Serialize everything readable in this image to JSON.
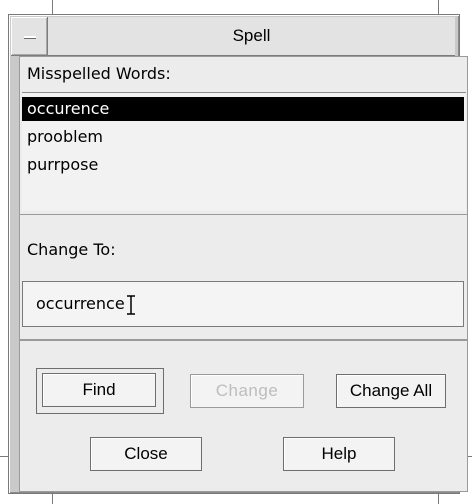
{
  "window": {
    "title": "Spell"
  },
  "misspelled": {
    "label": "Misspelled Words:",
    "words": [
      "occurence",
      "prooblem",
      "purrpose"
    ],
    "selected_index": 0
  },
  "change_to": {
    "label": "Change To:",
    "value": "occurrence"
  },
  "buttons": {
    "find": "Find",
    "change": "Change",
    "change_all": "Change All",
    "close": "Close",
    "help": "Help"
  },
  "colors": {
    "selection_bg": "#000000",
    "selection_fg": "#ffffff",
    "disabled_text": "#bdbdbd"
  }
}
